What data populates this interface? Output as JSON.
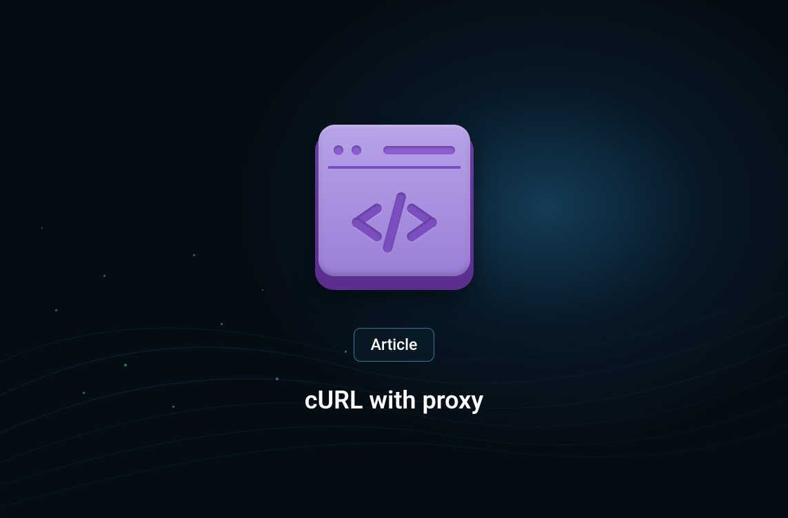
{
  "badge": {
    "label": "Article"
  },
  "title": "cURL with proxy",
  "icon": {
    "name": "code-window-icon",
    "accent_color": "#9b7fd8",
    "symbol_color": "#7b4fc0"
  },
  "theme": {
    "background": "#050d14",
    "badge_border": "#2a7a8f",
    "text_color": "#ffffff"
  }
}
